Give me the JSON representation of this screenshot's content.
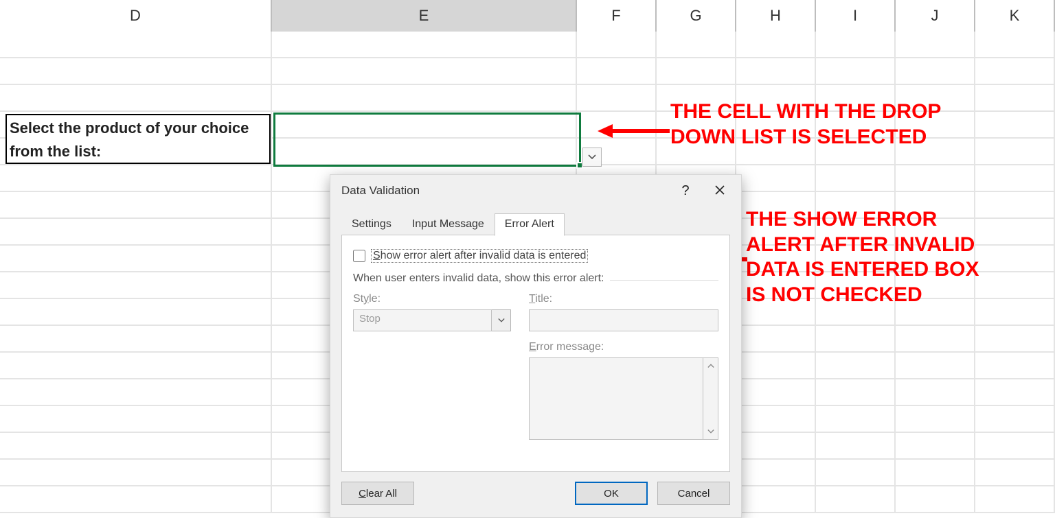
{
  "columns": [
    "D",
    "E",
    "F",
    "G",
    "H",
    "I",
    "J",
    "K"
  ],
  "selected_column": "E",
  "prompt_text": "Select the product of your choice from the list:",
  "annotation1": "THE CELL WITH THE DROP\nDOWN LIST IS SELECTED",
  "annotation2": "THE SHOW ERROR\nALERT AFTER INVALID\nDATA IS ENTERED BOX\nIS NOT CHECKED",
  "dialog": {
    "title": "Data Validation",
    "help": "?",
    "tabs": {
      "settings": "Settings",
      "input": "Input Message",
      "error": "Error Alert",
      "active": "error"
    },
    "checkbox_label_u": "S",
    "checkbox_label_rest": "how error alert after invalid data is entered",
    "checkbox_checked": false,
    "fieldset_legend": "When user enters invalid data, show this error alert:",
    "style_label_u": "y",
    "style_label_pre": "St",
    "style_label_post": "le:",
    "style_value": "Stop",
    "title_label_u": "T",
    "title_label_rest": "itle:",
    "errmsg_label_u": "E",
    "errmsg_label_rest": "rror message:",
    "clear_u": "C",
    "clear_rest": "lear All",
    "ok": "OK",
    "cancel": "Cancel"
  }
}
